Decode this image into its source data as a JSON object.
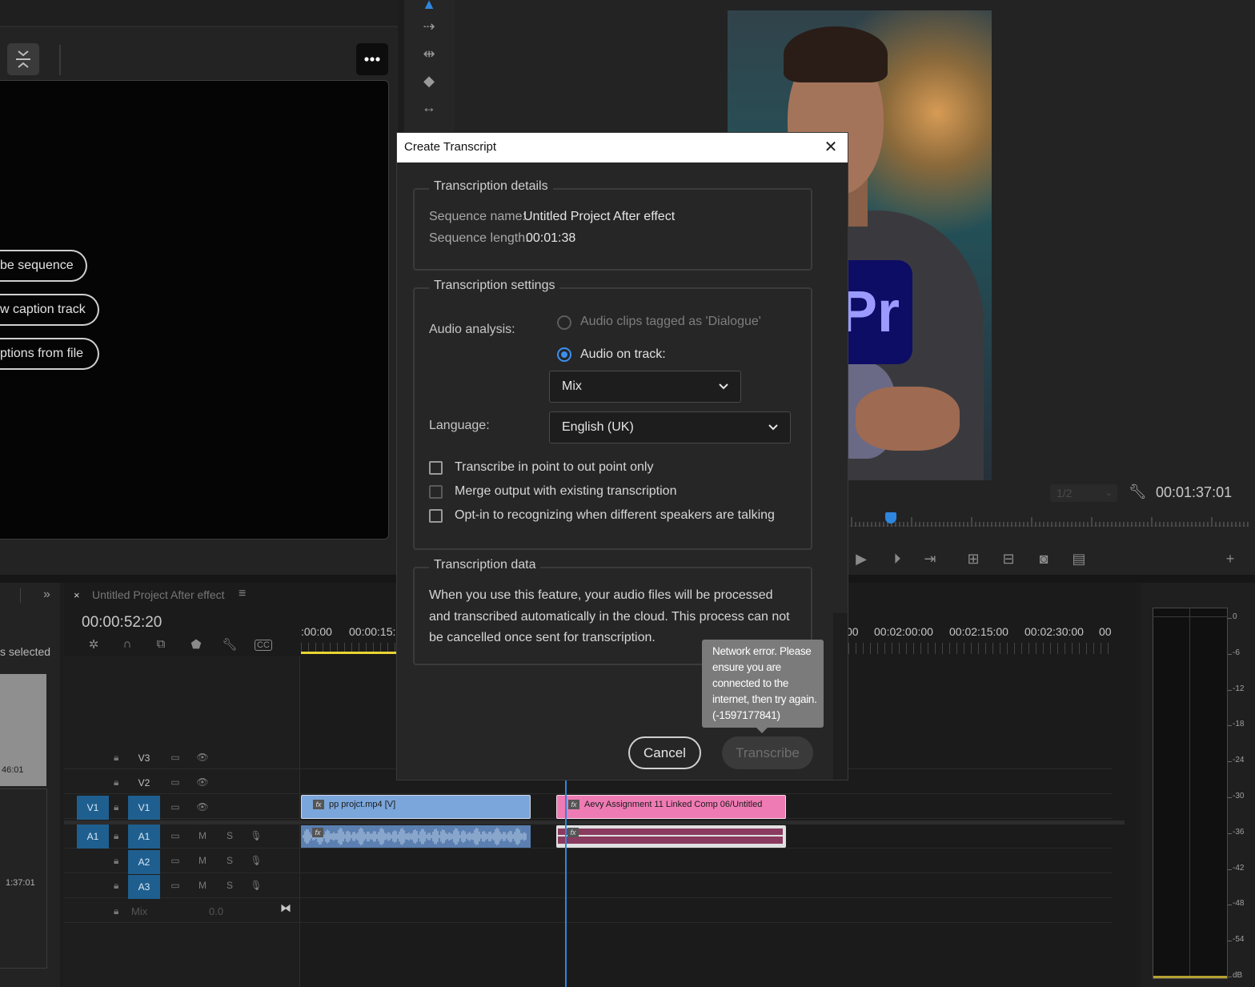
{
  "captions_panel": {
    "buttons": [
      {
        "label": "be sequence"
      },
      {
        "label": "w caption track"
      },
      {
        "label": "ptions from file"
      }
    ]
  },
  "monitor": {
    "zoom_select": "1/2",
    "timecode": "00:01:37:01",
    "pr_logo_text": "Pr"
  },
  "project_panel": {
    "chevrons": "»",
    "selection_text": "s selected",
    "thumb_duration": "46:01",
    "item_duration": "1:37:01"
  },
  "timeline": {
    "tab_close": "×",
    "tab_name": "Untitled Project After effect",
    "tab_menu": "≡",
    "timecode": "00:00:52:20",
    "ruler_labels": [
      ":00:00",
      "00:00:15:",
      "00",
      "00:02:00:00",
      "00:02:15:00",
      "00:02:30:00",
      "00"
    ],
    "tracks": {
      "v3": "V3",
      "v2": "V2",
      "v1_src": "V1",
      "v1": "V1",
      "a1_src": "A1",
      "a1": "A1",
      "a2": "A2",
      "a3": "A3"
    },
    "mute_label": "M",
    "solo_label": "S",
    "mix_label": "Mix",
    "mix_value": "0.0",
    "clips": {
      "video1": "pp projct.mp4 [V]",
      "video2": "Aevy Assignment 11 Linked Comp 06/Untitled",
      "fx": "fx"
    }
  },
  "audio_meter": {
    "db_scale": [
      "0",
      "-6",
      "-12",
      "-18",
      "-24",
      "-30",
      "-36",
      "-42",
      "-48",
      "-54",
      "dB"
    ]
  },
  "dialog": {
    "title": "Create Transcript",
    "close": "✕",
    "details": {
      "legend": "Transcription details",
      "sequence_name_label": "Sequence name:",
      "sequence_name": "Untitled Project After effect",
      "sequence_length_label": "Sequence length:",
      "sequence_length": "00:01:38"
    },
    "settings": {
      "legend": "Transcription settings",
      "audio_analysis_label": "Audio analysis:",
      "option_dialogue": "Audio clips tagged as 'Dialogue'",
      "option_track": "Audio on track:",
      "track_select": "Mix",
      "language_label": "Language:",
      "language_select": "English (UK)",
      "checkboxes": [
        {
          "label": "Transcribe in point to out point only",
          "checked": false
        },
        {
          "label": "Merge output with existing transcription",
          "checked": false
        },
        {
          "label": "Opt-in to recognizing when different speakers are talking",
          "checked": false
        }
      ]
    },
    "data": {
      "legend": "Transcription data",
      "text": "When you use this feature, your audio files will be processed and transcribed automatically in the cloud. This process can not be cancelled once sent for transcription."
    },
    "tooltip": "Network error. Please ensure you are connected to the internet, then try again.(-1597177841)",
    "cancel_label": "Cancel",
    "transcribe_label": "Transcribe"
  },
  "colors": {
    "accent": "#2e86de",
    "track_patch": "#1f5f8f",
    "video_clip": "#7ba6db",
    "linked_comp_clip": "#ef7bb4",
    "work_area": "#e7d432"
  }
}
